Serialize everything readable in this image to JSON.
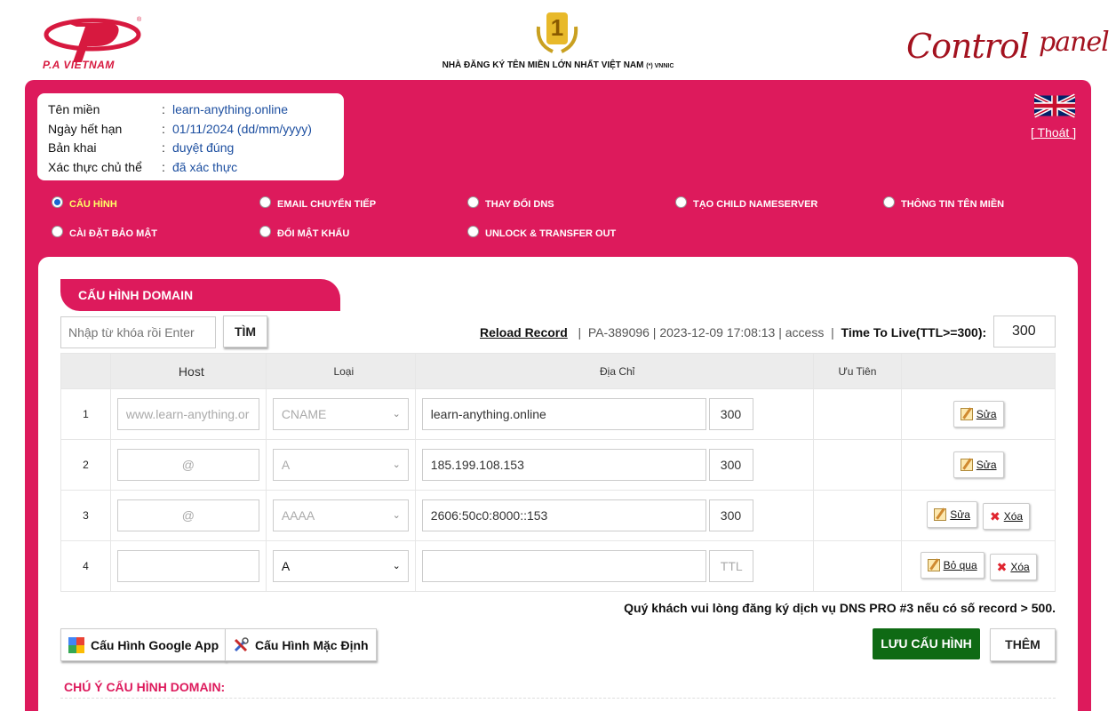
{
  "header": {
    "brand_text": "P.A VIETNAM",
    "award_number": "1",
    "tagline": "NHÀ ĐĂNG KÝ TÊN MIỀN LỚN NHẤT VIỆT NAM",
    "tagline_suffix": "(*) VNNIC",
    "cp_main": "Control",
    "cp_sub": "panel"
  },
  "domain_info": {
    "rows": [
      {
        "label": "Tên miền",
        "value": "learn-anything.online"
      },
      {
        "label": "Ngày hết hạn",
        "value": "01/11/2024 (dd/mm/yyyy)"
      },
      {
        "label": "Bản khai",
        "value": "duyệt đúng"
      },
      {
        "label": "Xác thực chủ thể",
        "value": "đã xác thực"
      }
    ],
    "separator": ":"
  },
  "logout_label": "[ Thoát ]",
  "menu": [
    {
      "label": "Cấu hình",
      "active": true
    },
    {
      "label": "Email chuyển tiếp",
      "active": false
    },
    {
      "label": "Thay đổi DNS",
      "active": false
    },
    {
      "label": "Tạo child nameserver",
      "active": false
    },
    {
      "label": "Thông tin tên miền",
      "active": false
    },
    {
      "label": "Cài đặt bảo mật",
      "active": false
    },
    {
      "label": "Đổi mật khẩu",
      "active": false
    },
    {
      "label": "Unlock & transfer out",
      "active": false
    }
  ],
  "panel": {
    "title": "CẤU HÌNH DOMAIN",
    "search_placeholder": "Nhập từ khóa rồi Enter",
    "search_button": "TÌM",
    "reload_link": "Reload Record",
    "log_info": "PA-389096 | 2023-12-09 17:08:13 | access",
    "ttl_label": "Time To Live(TTL>=300):",
    "ttl_value": "300"
  },
  "table": {
    "headers": {
      "num": "",
      "host": "Host",
      "type": "Loại",
      "address": "Địa Chỉ",
      "priority": "Ưu Tiên",
      "actions": ""
    },
    "rows": [
      {
        "num": "1",
        "host": "www.learn-anything.or",
        "type": "CNAME",
        "address": "learn-anything.online",
        "ttl": "300",
        "edit": "Sửa",
        "delete": ""
      },
      {
        "num": "2",
        "host": "@",
        "type": "A",
        "address": "185.199.108.153",
        "ttl": "300",
        "edit": "Sửa",
        "delete": ""
      },
      {
        "num": "3",
        "host": "@",
        "type": "AAAA",
        "address": "2606:50c0:8000::153",
        "ttl": "300",
        "edit": "Sửa",
        "delete": "Xóa"
      },
      {
        "num": "4",
        "host": "",
        "type": "A",
        "address": "",
        "ttl_placeholder": "TTL",
        "skip": "Bỏ qua",
        "delete": "Xóa"
      }
    ]
  },
  "notice": "Quý khách vui lòng đăng ký dịch vụ DNS PRO #3 nếu có số record > 500.",
  "buttons": {
    "google_app": "Cấu Hình Google App",
    "default_config": "Cấu Hình Mặc Định",
    "save": "LƯU CẤU HÌNH",
    "add": "THÊM"
  },
  "note_title": "CHÚ Ý CẤU HÌNH DOMAIN:",
  "colors": {
    "primary": "#dd1a5c",
    "save_green": "#0f6a14",
    "link_blue": "#1d4fa0",
    "active_label": "#ffff66"
  }
}
